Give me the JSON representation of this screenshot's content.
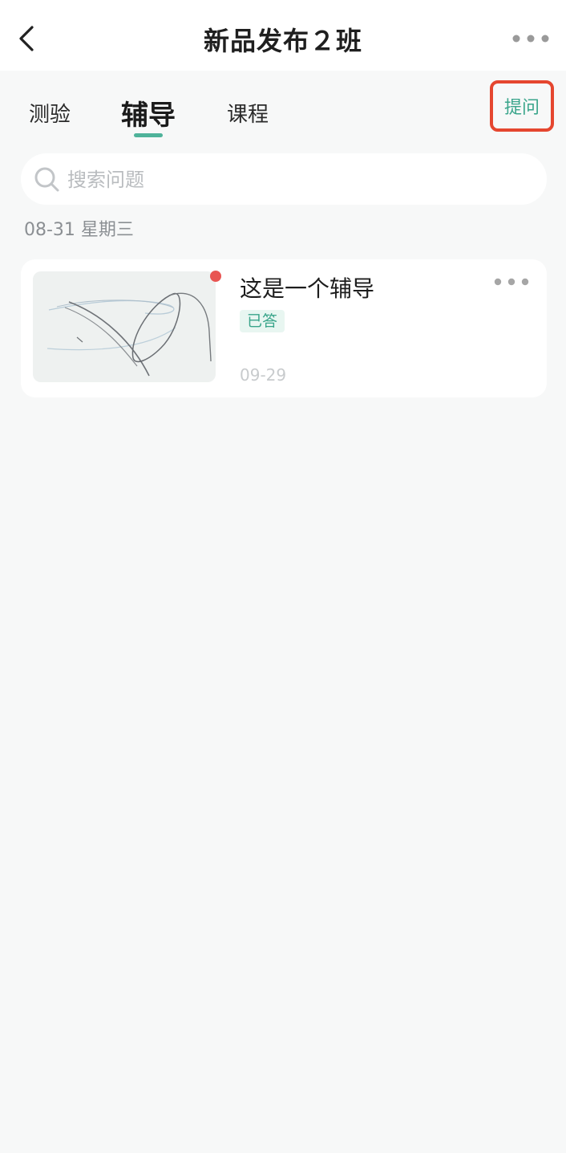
{
  "header": {
    "title": "新品发布２班",
    "back_icon": "chevron-left-icon",
    "more_icon": "more-horizontal-icon"
  },
  "tabs": [
    {
      "label": "测验",
      "active": false
    },
    {
      "label": "辅导",
      "active": true
    },
    {
      "label": "课程",
      "active": false
    }
  ],
  "ask_button": {
    "label": "提问",
    "highlight_color": "#e5462f"
  },
  "search": {
    "placeholder": "搜索问题",
    "value": ""
  },
  "groups": [
    {
      "date_label": "08-31 星期三",
      "items": [
        {
          "title": "这是一个辅导",
          "status": "已答",
          "date": "09-29",
          "unread": true,
          "thumbnail": "handwriting-sketch-image"
        }
      ]
    }
  ],
  "colors": {
    "accent": "#4fb39a",
    "accent_text": "#3aa58b",
    "unread_dot": "#e85552",
    "background": "#f7f8f8"
  }
}
